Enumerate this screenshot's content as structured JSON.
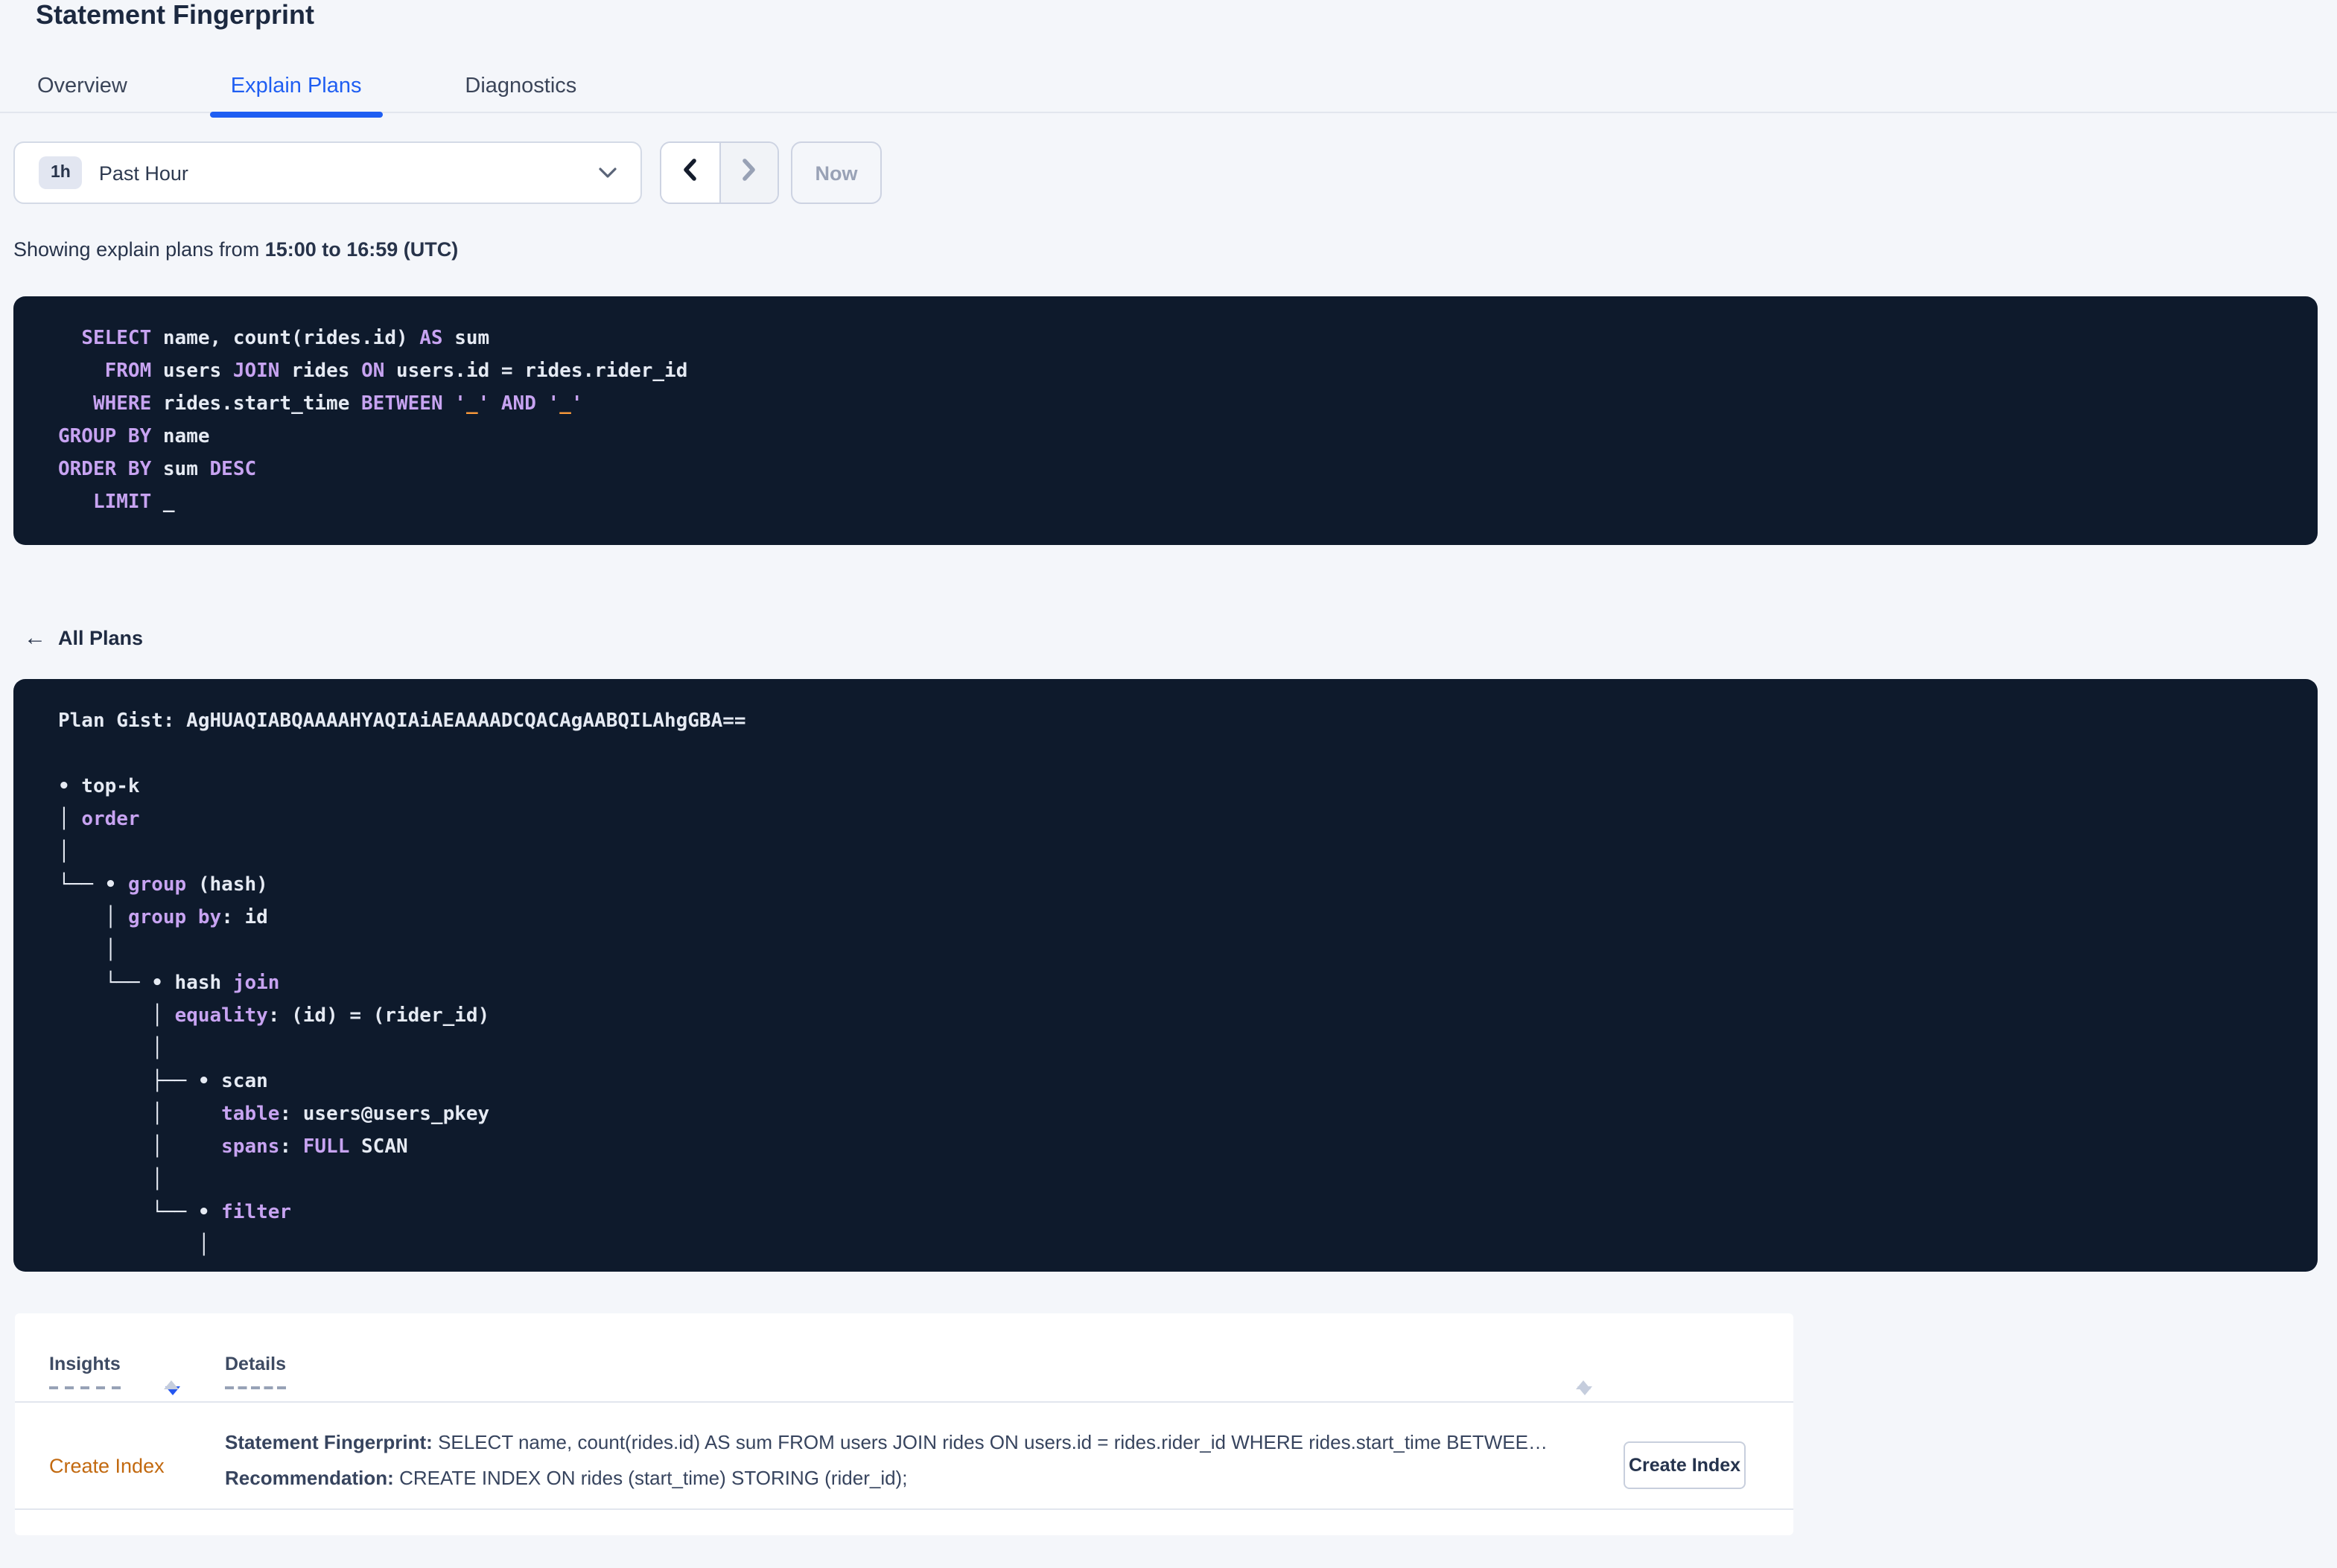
{
  "page": {
    "title": "Statement Fingerprint"
  },
  "tabs": [
    {
      "label": "Overview"
    },
    {
      "label": "Explain Plans"
    },
    {
      "label": "Diagnostics"
    }
  ],
  "time_picker": {
    "badge": "1h",
    "selected": "Past Hour"
  },
  "pager": {
    "now_label": "Now"
  },
  "showing": {
    "prefix": "Showing explain plans from ",
    "range_bold": "15:00 to 16:59 (UTC)"
  },
  "sql_statement": {
    "lines": [
      [
        [
          "p",
          "  "
        ],
        [
          "k",
          "SELECT"
        ],
        [
          "p",
          " name, count(rides.id) "
        ],
        [
          "k",
          "AS"
        ],
        [
          "p",
          " sum"
        ]
      ],
      [
        [
          "p",
          "    "
        ],
        [
          "k",
          "FROM"
        ],
        [
          "p",
          " users "
        ],
        [
          "k",
          "JOIN"
        ],
        [
          "p",
          " rides "
        ],
        [
          "k",
          "ON"
        ],
        [
          "p",
          " users.id = rides.rider_id"
        ]
      ],
      [
        [
          "p",
          "   "
        ],
        [
          "k",
          "WHERE"
        ],
        [
          "p",
          " rides.start_time "
        ],
        [
          "k",
          "BETWEEN"
        ],
        [
          "p",
          " "
        ],
        [
          "k",
          "'"
        ],
        [
          "o",
          "_"
        ],
        [
          "k",
          "'"
        ],
        [
          "p",
          " "
        ],
        [
          "k",
          "AND"
        ],
        [
          "p",
          " "
        ],
        [
          "k",
          "'"
        ],
        [
          "o",
          "_"
        ],
        [
          "k",
          "'"
        ]
      ],
      [
        [
          "k",
          "GROUP BY"
        ],
        [
          "p",
          " name"
        ]
      ],
      [
        [
          "k",
          "ORDER BY"
        ],
        [
          "p",
          " sum "
        ],
        [
          "k",
          "DESC"
        ]
      ],
      [
        [
          "p",
          "   "
        ],
        [
          "k",
          "LIMIT"
        ],
        [
          "p",
          " _"
        ]
      ]
    ]
  },
  "plan_section": {
    "back_label": "All Plans",
    "back_arrow": "←",
    "gist": "Plan Gist: AgHUAQIABQAAAAHYAQIAiAEAAAADCQACAgAABQILAhgGBA==",
    "tree_lines": [
      [
        [
          "p",
          "• top-k"
        ]
      ],
      [
        [
          "p",
          "│ "
        ],
        [
          "k",
          "order"
        ]
      ],
      [
        [
          "p",
          "│"
        ]
      ],
      [
        [
          "p",
          "└── • "
        ],
        [
          "k",
          "group"
        ],
        [
          "p",
          " (hash)"
        ]
      ],
      [
        [
          "p",
          "    │ "
        ],
        [
          "k",
          "group by"
        ],
        [
          "p",
          ": id"
        ]
      ],
      [
        [
          "p",
          "    │"
        ]
      ],
      [
        [
          "p",
          "    └── • hash "
        ],
        [
          "k",
          "join"
        ]
      ],
      [
        [
          "p",
          "        │ "
        ],
        [
          "k",
          "equality"
        ],
        [
          "p",
          ": (id) = (rider_id)"
        ]
      ],
      [
        [
          "p",
          "        │"
        ]
      ],
      [
        [
          "p",
          "        ├── • scan"
        ]
      ],
      [
        [
          "p",
          "        │     "
        ],
        [
          "k",
          "table"
        ],
        [
          "p",
          ": users@users_pkey"
        ]
      ],
      [
        [
          "p",
          "        │     "
        ],
        [
          "k",
          "spans"
        ],
        [
          "p",
          ": "
        ],
        [
          "k",
          "FULL"
        ],
        [
          "p",
          " SCAN"
        ]
      ],
      [
        [
          "p",
          "        │"
        ]
      ],
      [
        [
          "p",
          "        └── • "
        ],
        [
          "k",
          "filter"
        ]
      ],
      [
        [
          "p",
          "            │"
        ]
      ]
    ]
  },
  "insights_table": {
    "columns": [
      "Insights",
      "Details"
    ],
    "row": {
      "insight": "Create Index",
      "fingerprint_label": "Statement Fingerprint:",
      "fingerprint_value": "SELECT name, count(rides.id) AS sum FROM users JOIN rides ON users.id = rides.rider_id WHERE rides.start_time BETWEEN '_…",
      "recommendation_label": "Recommendation:",
      "recommendation_value": "CREATE INDEX ON rides (start_time) STORING (rider_id);",
      "action_label": "Create Index"
    }
  },
  "colors": {
    "accent_blue": "#1f5ef2",
    "code_bg": "#0e1a2c",
    "code_text": "#e5eaf3",
    "code_keyword": "#c7a3f1",
    "code_placeholder": "#f9993a",
    "insight_link": "#c2690f"
  }
}
